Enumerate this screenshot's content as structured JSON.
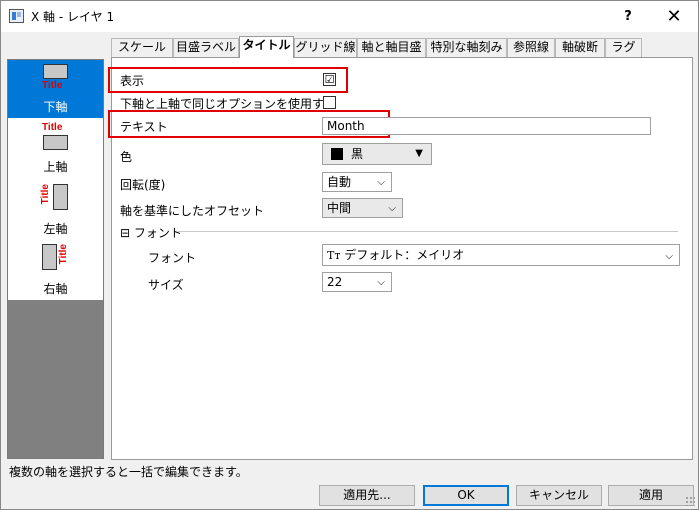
{
  "window": {
    "title": "X 軸 - レイヤ 1",
    "help_glyph": "?",
    "close_glyph": "✕"
  },
  "axes": [
    {
      "label": "下軸",
      "icon_text": "Title",
      "selected": true
    },
    {
      "label": "上軸",
      "icon_text": "Title",
      "selected": false
    },
    {
      "label": "左軸",
      "icon_text": "Title",
      "selected": false
    },
    {
      "label": "右軸",
      "icon_text": "Title",
      "selected": false
    }
  ],
  "tabs": [
    "スケール",
    "目盛ラベル",
    "タイトル",
    "グリッド線",
    "軸と軸目盛",
    "特別な軸刻み",
    "参照線",
    "軸破断",
    "ラグ"
  ],
  "active_tab": "タイトル",
  "form": {
    "show_label": "表示",
    "show_checked": "☑",
    "same_option_label": "下軸と上軸で同じオプションを使用する",
    "text_label": "テキスト",
    "text_value": "Month",
    "color_label": "色",
    "color_value": "黒",
    "color_swatch": "#000000",
    "rotation_label": "回転(度)",
    "rotation_value": "自動",
    "offset_label": "軸を基準にしたオフセット",
    "offset_value": "中間",
    "font_group_label": "フォント",
    "font_group_toggle": "⊟",
    "font_label": "フォント",
    "font_value": "デフォルト：メイリオ",
    "font_icon": "Tт",
    "size_label": "サイズ",
    "size_value": "22"
  },
  "status_text": "複数の軸を選択すると一括で編集できます。",
  "buttons": {
    "apply_to": "適用先...",
    "ok": "OK",
    "cancel": "キャンセル",
    "apply": "適用"
  },
  "colors": {
    "selection": "#0078d7",
    "highlight": "#e00000",
    "title_red": "#e00000"
  }
}
